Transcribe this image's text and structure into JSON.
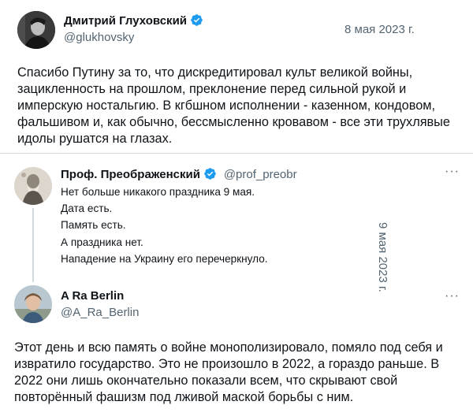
{
  "main_tweet": {
    "author_name": "Дмитрий Глуховский",
    "handle": "@glukhovsky",
    "date": "8 мая 2023 г.",
    "text_lines": [
      "Спасибо Путину за то, что дискредитировал культ великой войны,",
      "зацикленность на прошлом, преклонение перед сильной рукой и",
      "имперскую ностальгию. В кгбшном исполнении - казенном, кондовом,",
      "фальшивом и, как обычно, бессмысленно кровавом - все эти трухлявые",
      "идолы рушатся на глазах."
    ]
  },
  "quoted_tweet": {
    "author_name": "Проф. Преображенский",
    "handle": "@prof_preobr",
    "lines": [
      "Нет больше никакого праздника 9 мая.",
      "Дата есть.",
      "Память есть.",
      "А праздника нет.",
      "Нападение на Украину его перечеркнуло."
    ],
    "date": "9 мая 2023 г."
  },
  "reply_tweet": {
    "author_name": "A Ra Berlin",
    "handle": "@A_Ra_Berlin",
    "text_lines": [
      "Этот день и всю память о войне монополизировало, помяло под себя и",
      "извратило государство. Это не произошло в 2022, а гораздо раньше. В",
      "2022 они лишь окончательно показали всем, что скрывают свой",
      "повторённый фашизм под лживой маской борьбы с ним."
    ]
  },
  "more_label": "···",
  "colors": {
    "verified": "#1d9bf0",
    "secondary": "#536471",
    "divider": "#cfd9de"
  },
  "icons": [
    "verified-badge-icon",
    "more-options-icon"
  ]
}
